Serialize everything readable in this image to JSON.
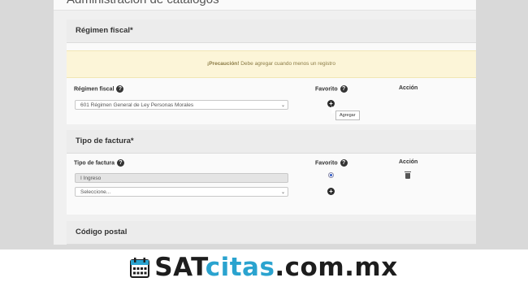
{
  "page": {
    "heading": "Administración de catálogos"
  },
  "regimen_card": {
    "title": "Régimen fiscal*",
    "alert_strong": "¡Precaución!",
    "alert_text": " Debe agregar cuando menos un registro",
    "col_regimen": "Régimen fiscal",
    "col_favorito": "Favorito",
    "col_accion": "Acción",
    "select_value": "601 Régimen General de Ley Personas Morales",
    "tooltip": "Agregar"
  },
  "tipo_card": {
    "title": "Tipo de factura*",
    "col_tipo": "Tipo de factura",
    "col_favorito": "Favorito",
    "col_accion": "Acción",
    "row_value": "I Ingreso",
    "select_placeholder": "Seleccione..."
  },
  "codigo_card": {
    "title": "Código postal"
  },
  "footer": {
    "brand_part1": "SAT",
    "brand_part2": "citas",
    "brand_part3": ".com.mx"
  },
  "colors": {
    "brand_dark": "#1d1d1d",
    "brand_accent": "#2aa3cf",
    "alert_bg": "#fcf5d8"
  },
  "icons": [
    "help-icon",
    "plus-icon",
    "trash-icon",
    "calendar-icon",
    "chevron-down-icon",
    "radio-selected"
  ]
}
